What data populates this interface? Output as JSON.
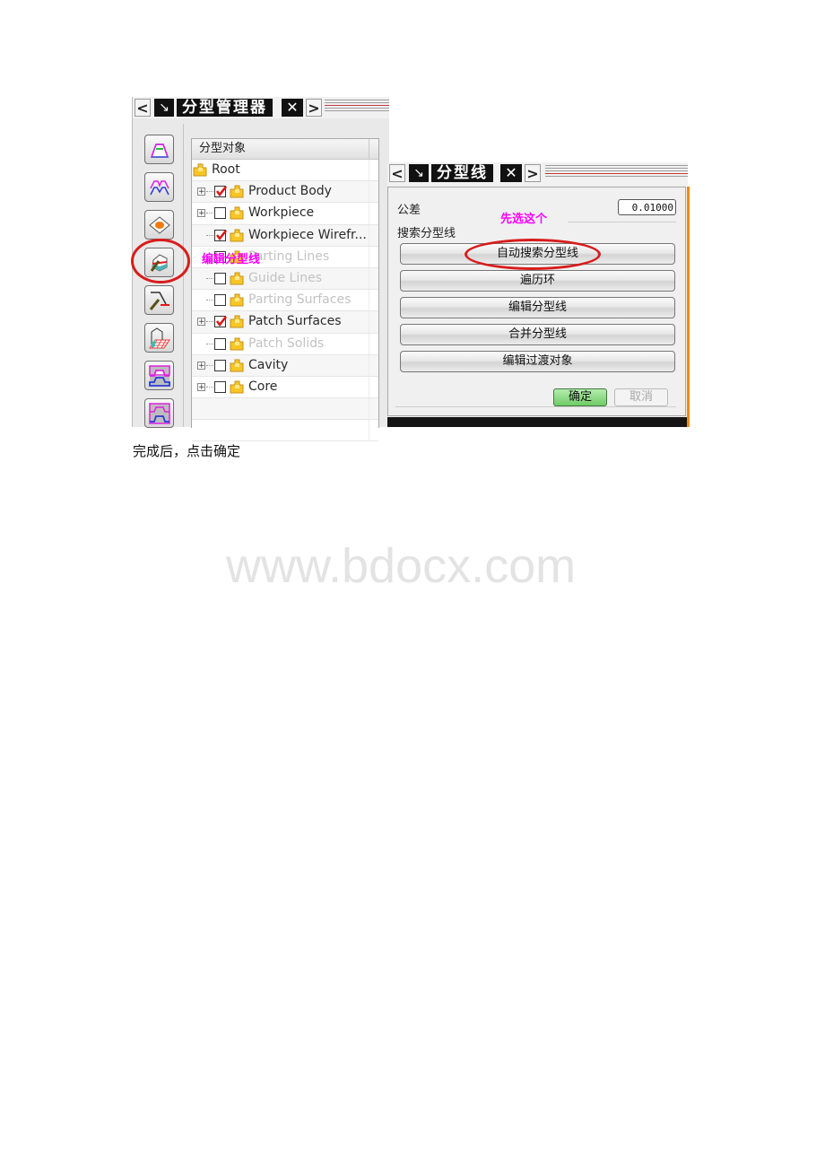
{
  "parting_manager": {
    "title": "分型管理器",
    "nav_prev": "<",
    "nav_next": ">",
    "pin_glyph": "↘",
    "close_glyph": "✕",
    "tools": [
      {
        "name": "parting-design-icon"
      },
      {
        "name": "region-split-icon"
      },
      {
        "name": "patch-surface-icon"
      },
      {
        "name": "edit-parting-line-icon"
      },
      {
        "name": "edit-guide-line-icon"
      },
      {
        "name": "parting-surface-grid-icon"
      },
      {
        "name": "define-cavity-icon"
      },
      {
        "name": "define-core-icon"
      }
    ],
    "tree": {
      "header": "分型对象",
      "rows": [
        {
          "label": "Root",
          "level": 0,
          "expander": false,
          "checked": null,
          "disabled": false
        },
        {
          "label": "Product Body",
          "level": 1,
          "expander": true,
          "checked": true,
          "disabled": false
        },
        {
          "label": "Workpiece",
          "level": 1,
          "expander": true,
          "checked": false,
          "disabled": false
        },
        {
          "label": "Workpiece Wirefr...",
          "level": 1,
          "expander": false,
          "checked": true,
          "disabled": false
        },
        {
          "label": "Parting Lines",
          "level": 1,
          "expander": false,
          "checked": false,
          "disabled": true
        },
        {
          "label": "Guide Lines",
          "level": 1,
          "expander": false,
          "checked": false,
          "disabled": true
        },
        {
          "label": "Parting Surfaces",
          "level": 1,
          "expander": false,
          "checked": false,
          "disabled": true
        },
        {
          "label": "Patch Surfaces",
          "level": 1,
          "expander": true,
          "checked": true,
          "disabled": false
        },
        {
          "label": "Patch Solids",
          "level": 1,
          "expander": false,
          "checked": false,
          "disabled": true
        },
        {
          "label": "Cavity",
          "level": 1,
          "expander": true,
          "checked": false,
          "disabled": false
        },
        {
          "label": "Core",
          "level": 1,
          "expander": true,
          "checked": false,
          "disabled": false
        }
      ]
    },
    "annotation": "编辑分型线"
  },
  "parting_line": {
    "title": "分型线",
    "nav_prev": "<",
    "nav_next": ">",
    "pin_glyph": "↘",
    "close_glyph": "✕",
    "tolerance_label": "公差",
    "tolerance_value": "0.01000",
    "search_label": "搜索分型线",
    "buttons": [
      "自动搜索分型线",
      "遍历环",
      "编辑分型线",
      "合并分型线",
      "编辑过渡对象"
    ],
    "ok_label": "确定",
    "cancel_label": "取消",
    "annotation": "先选这个",
    "colors": {
      "ok": "#6fcb66",
      "accent_edge": "#ee8c16",
      "annotation": "#ff00ff",
      "highlight_ring": "#d81c1c"
    }
  },
  "caption": "完成后，点击确定",
  "watermark": "www.bdocx.com"
}
